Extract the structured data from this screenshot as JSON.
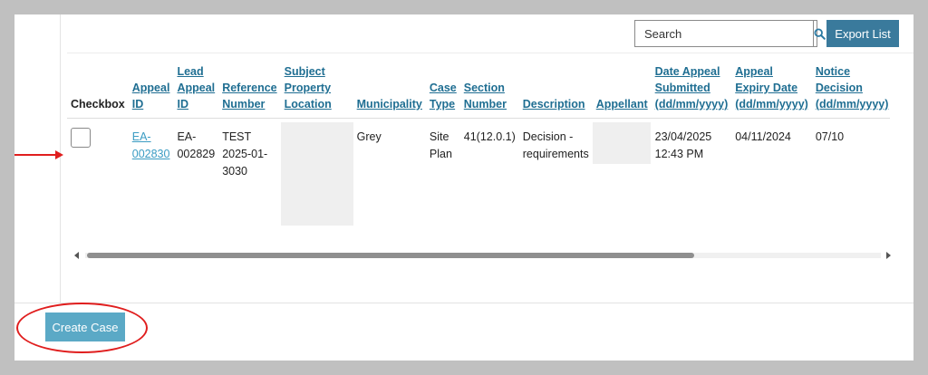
{
  "toolbar": {
    "search_placeholder": "Search",
    "export_label": "Export List"
  },
  "table": {
    "headers": {
      "checkbox": "Checkbox",
      "appeal_id": "Appeal ID",
      "lead_appeal_id": "Lead Appeal ID",
      "reference_number": "Reference Number",
      "subject_property_location": "Subject Property Location",
      "municipality": "Municipality",
      "case_type": "Case Type",
      "section_number": "Section Number",
      "description": "Description",
      "appellant": "Appellant",
      "date_appeal_submitted": "Date Appeal Submitted (dd/mm/yyyy)",
      "appeal_expiry_date": "Appeal Expiry Date (dd/mm/yyyy)",
      "notice_decision": "Notice Decision (dd/mm/yyyy)"
    },
    "rows": [
      {
        "appeal_id": "EA-002830",
        "lead_appeal_id": "EA-002829",
        "reference_number": "TEST 2025-01-3030",
        "municipality": "Grey",
        "case_type": "Site Plan",
        "section_number": "41(12.0.1)",
        "description": "Decision - requirements",
        "date_appeal_submitted": "23/04/2025 12:43 PM",
        "appeal_expiry_date": "04/11/2024",
        "notice_decision": "07/10"
      }
    ]
  },
  "actions": {
    "create_case_label": "Create Case"
  },
  "colors": {
    "primary_button": "#3a7a9c",
    "create_button": "#5ba9c6",
    "link": "#1f6e92",
    "annotation": "#e01e1e"
  }
}
